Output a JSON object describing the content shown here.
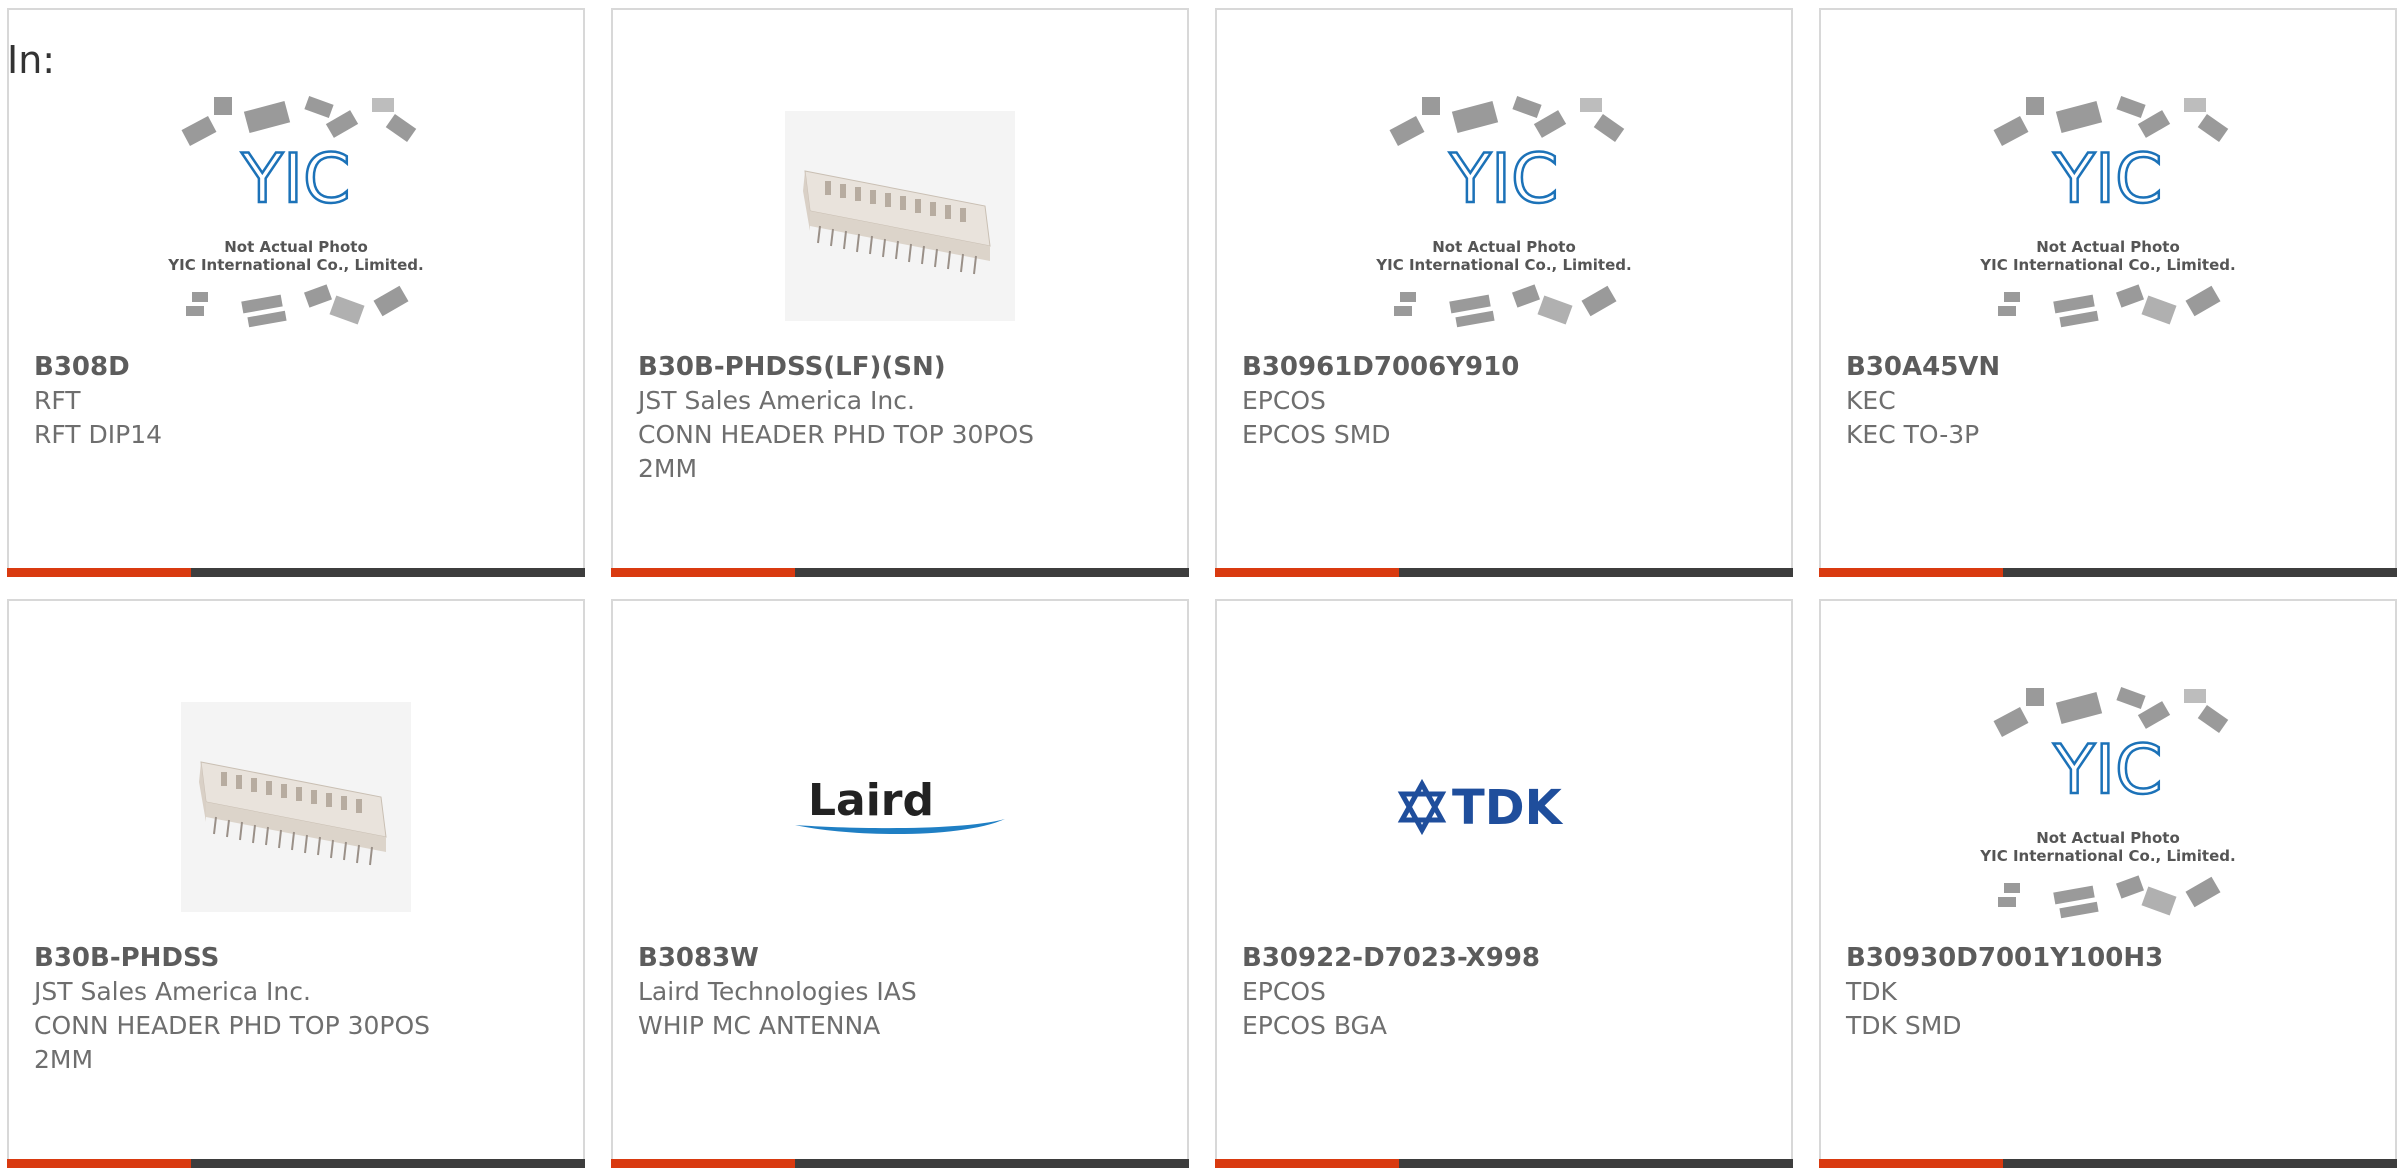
{
  "header": {
    "in_label": "In:"
  },
  "placeholder": {
    "line1": "Not Actual Photo",
    "line2": "YIC International Co., Limited.",
    "logo": "YIC"
  },
  "colors": {
    "accent": "#d93a10",
    "bar": "#3d3d3d",
    "border": "#d8d8d8",
    "yic_blue": "#1c72b8"
  },
  "cards": [
    {
      "part": "B308D",
      "maker": "RFT",
      "desc": "RFT DIP14",
      "image": "not-actual-photo-placeholder"
    },
    {
      "part": "B30B-PHDSS(LF)(SN)",
      "maker": "JST Sales America Inc.",
      "desc": "CONN HEADER PHD TOP 30POS 2MM",
      "image": "connector-header-photo"
    },
    {
      "part": "B30961D7006Y910",
      "maker": "EPCOS",
      "desc": "EPCOS SMD",
      "image": "not-actual-photo-placeholder"
    },
    {
      "part": "B30A45VN",
      "maker": "KEC",
      "desc": "KEC TO-3P",
      "image": "not-actual-photo-placeholder"
    },
    {
      "part": "B30B-PHDSS",
      "maker": "JST Sales America Inc.",
      "desc": "CONN HEADER PHD TOP 30POS 2MM",
      "image": "connector-header-photo"
    },
    {
      "part": "B3083W",
      "maker": "Laird Technologies IAS",
      "desc": "WHIP MC ANTENNA",
      "image": "laird-logo",
      "logo_text": "Laird"
    },
    {
      "part": "B30922-D7023-X998",
      "maker": "EPCOS",
      "desc": "EPCOS BGA",
      "image": "tdk-logo",
      "logo_text": "TDK"
    },
    {
      "part": "B30930D7001Y100H3",
      "maker": "TDK",
      "desc": "TDK SMD",
      "image": "not-actual-photo-placeholder"
    }
  ]
}
